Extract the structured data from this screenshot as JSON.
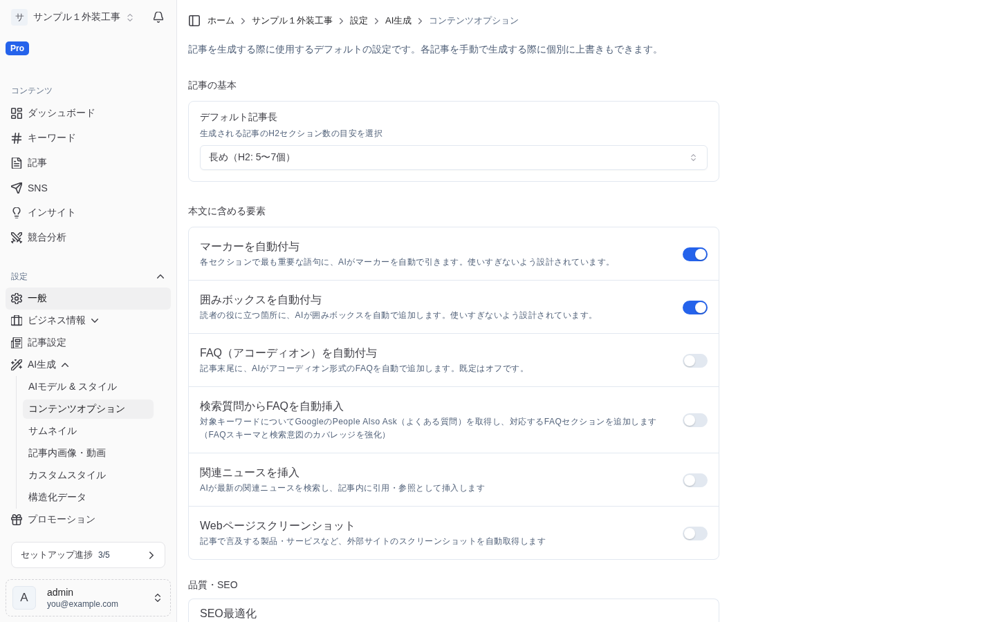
{
  "sidebar": {
    "workspace": {
      "initial": "サ",
      "name": "サンプル１外装工事"
    },
    "plan_badge": "Pro",
    "sections": [
      {
        "label": "コンテンツ",
        "items": [
          {
            "label": "ダッシュボード",
            "selected": false
          },
          {
            "label": "キーワード",
            "selected": false
          },
          {
            "label": "記事",
            "selected": false
          },
          {
            "label": "SNS",
            "selected": false
          },
          {
            "label": "インサイト",
            "selected": false
          },
          {
            "label": "競合分析",
            "selected": false
          }
        ]
      },
      {
        "label": "設定",
        "expanded": true,
        "items": [
          {
            "label": "一般",
            "selected": true
          },
          {
            "label": "ビジネス情報",
            "selected": false,
            "expanded": false
          },
          {
            "label": "記事設定",
            "selected": false
          },
          {
            "label": "AI生成",
            "selected": false,
            "expanded": true,
            "children": [
              {
                "label": "AIモデル & スタイル",
                "selected": false
              },
              {
                "label": "コンテンツオプション",
                "selected": true
              },
              {
                "label": "サムネイル",
                "selected": false
              },
              {
                "label": "記事内画像・動画",
                "selected": false
              },
              {
                "label": "カスタムスタイル",
                "selected": false
              },
              {
                "label": "構造化データ",
                "selected": false
              }
            ]
          },
          {
            "label": "プロモーション",
            "selected": false
          }
        ]
      }
    ],
    "setup_progress": {
      "label": "セットアップ進捗",
      "count": "3/5"
    },
    "account": {
      "initial": "A",
      "name": "admin",
      "email": "you@example.com"
    }
  },
  "main": {
    "breadcrumb": [
      "ホーム",
      "サンプル１外装工事",
      "設定",
      "AI生成",
      "コンテンツオプション"
    ],
    "description": "記事を生成する際に使用するデフォルトの設定です。各記事を手動で生成する際に個別に上書きもできます。",
    "sections": [
      {
        "title": "記事の基本",
        "rows": [
          {
            "kind": "select",
            "label": "デフォルト記事長",
            "hint": "生成される記事のH2セクション数の目安を選択",
            "value": "長め（H2: 5〜7個）"
          }
        ]
      },
      {
        "title": "本文に含める要素",
        "rows": [
          {
            "kind": "toggle",
            "label": "マーカーを自動付与",
            "description": "各セクションで最も重要な語句に、AIがマーカーを自動で引きます。使いすぎないよう設計されています。",
            "on": true
          },
          {
            "kind": "toggle",
            "label": "囲みボックスを自動付与",
            "description": "読者の役に立つ箇所に、AIが囲みボックスを自動で追加します。使いすぎないよう設計されています。",
            "on": true
          },
          {
            "kind": "toggle",
            "label": "FAQ（アコーディオン）を自動付与",
            "description": "記事末尾に、AIがアコーディオン形式のFAQを自動で追加します。既定はオフです。",
            "on": false
          },
          {
            "kind": "toggle",
            "label": "検索質問からFAQを自動挿入",
            "description": "対象キーワードについてGoogleのPeople Also Ask（よくある質問）を取得し、対応するFAQセクションを追加します（FAQスキーマと検索意図のカバレッジを強化）",
            "on": false
          },
          {
            "kind": "toggle",
            "label": "関連ニュースを挿入",
            "description": "AIが最新の関連ニュースを検索し、記事内に引用・参照として挿入します",
            "on": false
          },
          {
            "kind": "toggle",
            "label": "Webページスクリーンショット",
            "description": "記事で言及する製品・サービスなど、外部サイトのスクリーンショットを自動取得します",
            "on": false
          }
        ]
      },
      {
        "title": "品質・SEO",
        "rows": [
          {
            "kind": "partial",
            "label": "SEO最適化"
          }
        ]
      }
    ]
  }
}
